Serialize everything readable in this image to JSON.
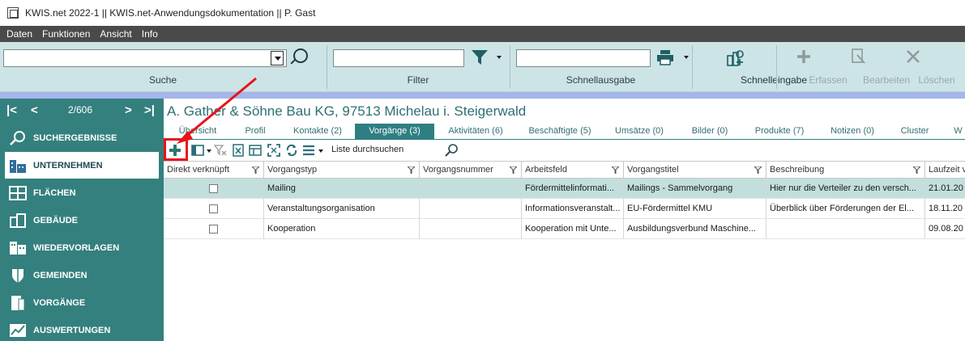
{
  "window": {
    "title": "KWIS.net 2022-1 || KWIS.net-Anwendungsdokumentation || P. Gast"
  },
  "menu": [
    "Daten",
    "Funktionen",
    "Ansicht",
    "Info"
  ],
  "ribbon": {
    "search_label": "Suche",
    "search_value": "",
    "filter_label": "Filter",
    "filter_value": "",
    "quick_output_label": "Schnellausgabe",
    "quick_output_value": "",
    "quick_entry_label": "Schnelleingabe",
    "capture_label": "Erfassen",
    "edit_label": "Bearbeiten",
    "delete_label": "Löschen"
  },
  "navigator": {
    "first": "|<",
    "prev": "<",
    "position": "2/606",
    "next": ">",
    "last": ">|"
  },
  "sidebar": {
    "items": [
      {
        "label": "SUCHERGEBNISSE"
      },
      {
        "label": "UNTERNEHMEN"
      },
      {
        "label": "FLÄCHEN"
      },
      {
        "label": "GEBÄUDE"
      },
      {
        "label": "WIEDERVORLAGEN"
      },
      {
        "label": "GEMEINDEN"
      },
      {
        "label": "VORGÄNGE"
      },
      {
        "label": "AUSWERTUNGEN"
      }
    ]
  },
  "company": {
    "title": "A. Gather & Söhne Bau KG, 97513 Michelau i. Steigerwald"
  },
  "tabs": [
    {
      "label": "Übersicht"
    },
    {
      "label": "Profil"
    },
    {
      "label": "Kontakte (2)"
    },
    {
      "label": "Vorgänge (3)"
    },
    {
      "label": "Aktivitäten (6)"
    },
    {
      "label": "Beschäftigte (5)"
    },
    {
      "label": "Umsätze (0)"
    },
    {
      "label": "Bilder (0)"
    },
    {
      "label": "Produkte (7)"
    },
    {
      "label": "Notizen (0)"
    },
    {
      "label": "Cluster"
    },
    {
      "label": "W"
    }
  ],
  "toolbar": {
    "search_list_label": "Liste durchsuchen"
  },
  "table": {
    "columns": [
      "Direkt verknüpft",
      "Vorgangstyp",
      "Vorgangsnummer",
      "Arbeitsfeld",
      "Vorgangstitel",
      "Beschreibung",
      "Laufzeit v"
    ],
    "rows": [
      {
        "direct": false,
        "type": "Mailing",
        "number": "",
        "field": "Fördermittelinformati...",
        "title": "Mailings - Sammelvorgang",
        "description": "Hier nur die Verteiler zu den versch...",
        "runtime": "21.01.20"
      },
      {
        "direct": false,
        "type": "Veranstaltungsorganisation",
        "number": "",
        "field": "Informationsveranstalt...",
        "title": "EU-Fördermittel KMU",
        "description": "Überblick über Förderungen der El...",
        "runtime": "18.11.20"
      },
      {
        "direct": false,
        "type": "Kooperation",
        "number": "",
        "field": "Kooperation mit Unte...",
        "title": "Ausbildungsverbund Maschine...",
        "description": "",
        "runtime": "09.08.20"
      }
    ]
  },
  "colors": {
    "sidebar": "#34807e",
    "ribbon": "#cde4e6",
    "accent": "#2f7f82",
    "highlight": "#e8131b"
  }
}
